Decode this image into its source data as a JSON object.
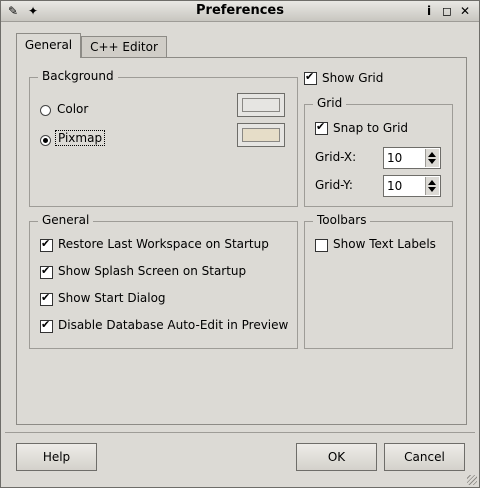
{
  "window": {
    "title": "Preferences",
    "icons": {
      "left": "editor-app-icon",
      "pin": "pin-icon",
      "help": "help-icon",
      "maximize": "maximize-icon",
      "close": "close-icon"
    }
  },
  "tabs": [
    {
      "label": "General"
    },
    {
      "label": "C++ Editor"
    }
  ],
  "background": {
    "legend": "Background",
    "color_label": "Color",
    "pixmap_label": "Pixmap",
    "selected": "Pixmap",
    "color_swatch": "#e6e5e2",
    "pixmap_swatch": "#e6ddc8"
  },
  "grid": {
    "show_grid_label": "Show Grid",
    "legend": "Grid",
    "snap_label": "Snap to Grid",
    "grid_x_label": "Grid-X:",
    "grid_x_value": "10",
    "grid_y_label": "Grid-Y:",
    "grid_y_value": "10"
  },
  "general": {
    "legend": "General",
    "options": [
      {
        "label": "Restore Last Workspace on Startup",
        "checked": true
      },
      {
        "label": "Show Splash Screen on Startup",
        "checked": true
      },
      {
        "label": "Show Start Dialog",
        "checked": true
      },
      {
        "label": "Disable Database Auto-Edit in Preview",
        "checked": true
      }
    ]
  },
  "toolbars": {
    "legend": "Toolbars",
    "show_text_labels": "Show Text Labels"
  },
  "buttons": {
    "help": "Help",
    "ok": "OK",
    "cancel": "Cancel"
  }
}
